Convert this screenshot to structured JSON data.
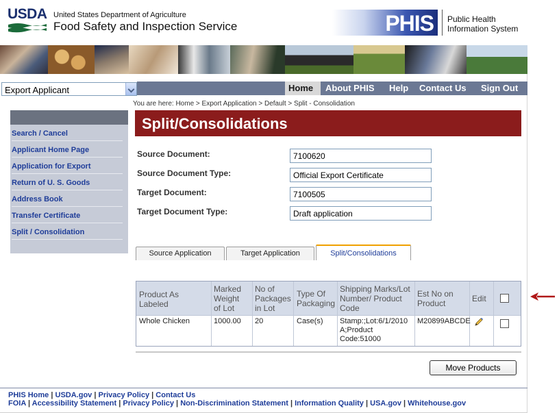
{
  "header": {
    "usda_logo": "USDA",
    "agency_small": "United States Department of Agriculture",
    "agency_big": "Food Safety and Inspection Service",
    "phis_logo": "PHIS",
    "phis_line1": "Public Health",
    "phis_line2": "Information System"
  },
  "nav": {
    "role_select": "Export Applicant",
    "items": [
      "Home",
      "About PHIS",
      "Help",
      "Contact Us",
      "Sign Out"
    ]
  },
  "breadcrumb": "You are here: Home > Export Application > Default > Split - Consolidation",
  "sidebar": {
    "items": [
      "Search / Cancel",
      "Applicant Home Page",
      "Application for Export",
      "Return of U. S. Goods",
      "Address Book",
      "Transfer Certificate",
      "Split / Consolidation"
    ]
  },
  "page_title": "Split/Consolidations",
  "form": {
    "source_document_label": "Source Document:",
    "source_document_value": "7100620",
    "source_document_type_label": "Source Document Type:",
    "source_document_type_value": "Official Export Certificate",
    "target_document_label": "Target Document:",
    "target_document_value": "7100505",
    "target_document_type_label": "Target Document Type:",
    "target_document_type_value": "Draft application"
  },
  "tabs": [
    "Source Application",
    "Target Application",
    "Split/Consolidations"
  ],
  "table": {
    "headers": {
      "product": "Product As Labeled",
      "weight_1": "Marked",
      "weight_2": "Weight",
      "weight_3": "of Lot",
      "packages_1": "No of",
      "packages_2": "Packages",
      "packages_3": "in Lot",
      "packaging_1": "Type Of",
      "packaging_2": "Packaging",
      "marks_1": "Shipping Marks/Lot",
      "marks_2": "Number/ Product",
      "marks_3": "Code",
      "estno_1": "Est No on",
      "estno_2": "Product",
      "edit": "Edit"
    },
    "rows": [
      {
        "product": "Whole Chicken",
        "weight": "1000.00",
        "packages": "20",
        "packaging": "Case(s)",
        "marks_1": "Stamp:;Lot:6/1/2010",
        "marks_2": "A;Product",
        "marks_3": "Code:51000",
        "estno": "M20899ABCDE"
      }
    ]
  },
  "move_button": "Move Products",
  "footer": {
    "line1": [
      "PHIS Home",
      "USDA.gov",
      "Privacy Policy",
      "Contact Us"
    ],
    "line2": [
      "FOIA",
      "Accessibility Statement",
      "Privacy Policy",
      "Non-Discrimination Statement",
      "Information Quality",
      "USA.gov",
      "Whitehouse.gov"
    ],
    "separator": "|"
  },
  "colors": {
    "title_bar": "#8b1c1c",
    "nav_bar": "#6b7894",
    "link_blue": "#1f3d99",
    "sidebar_bg": "#c6cbd7"
  }
}
